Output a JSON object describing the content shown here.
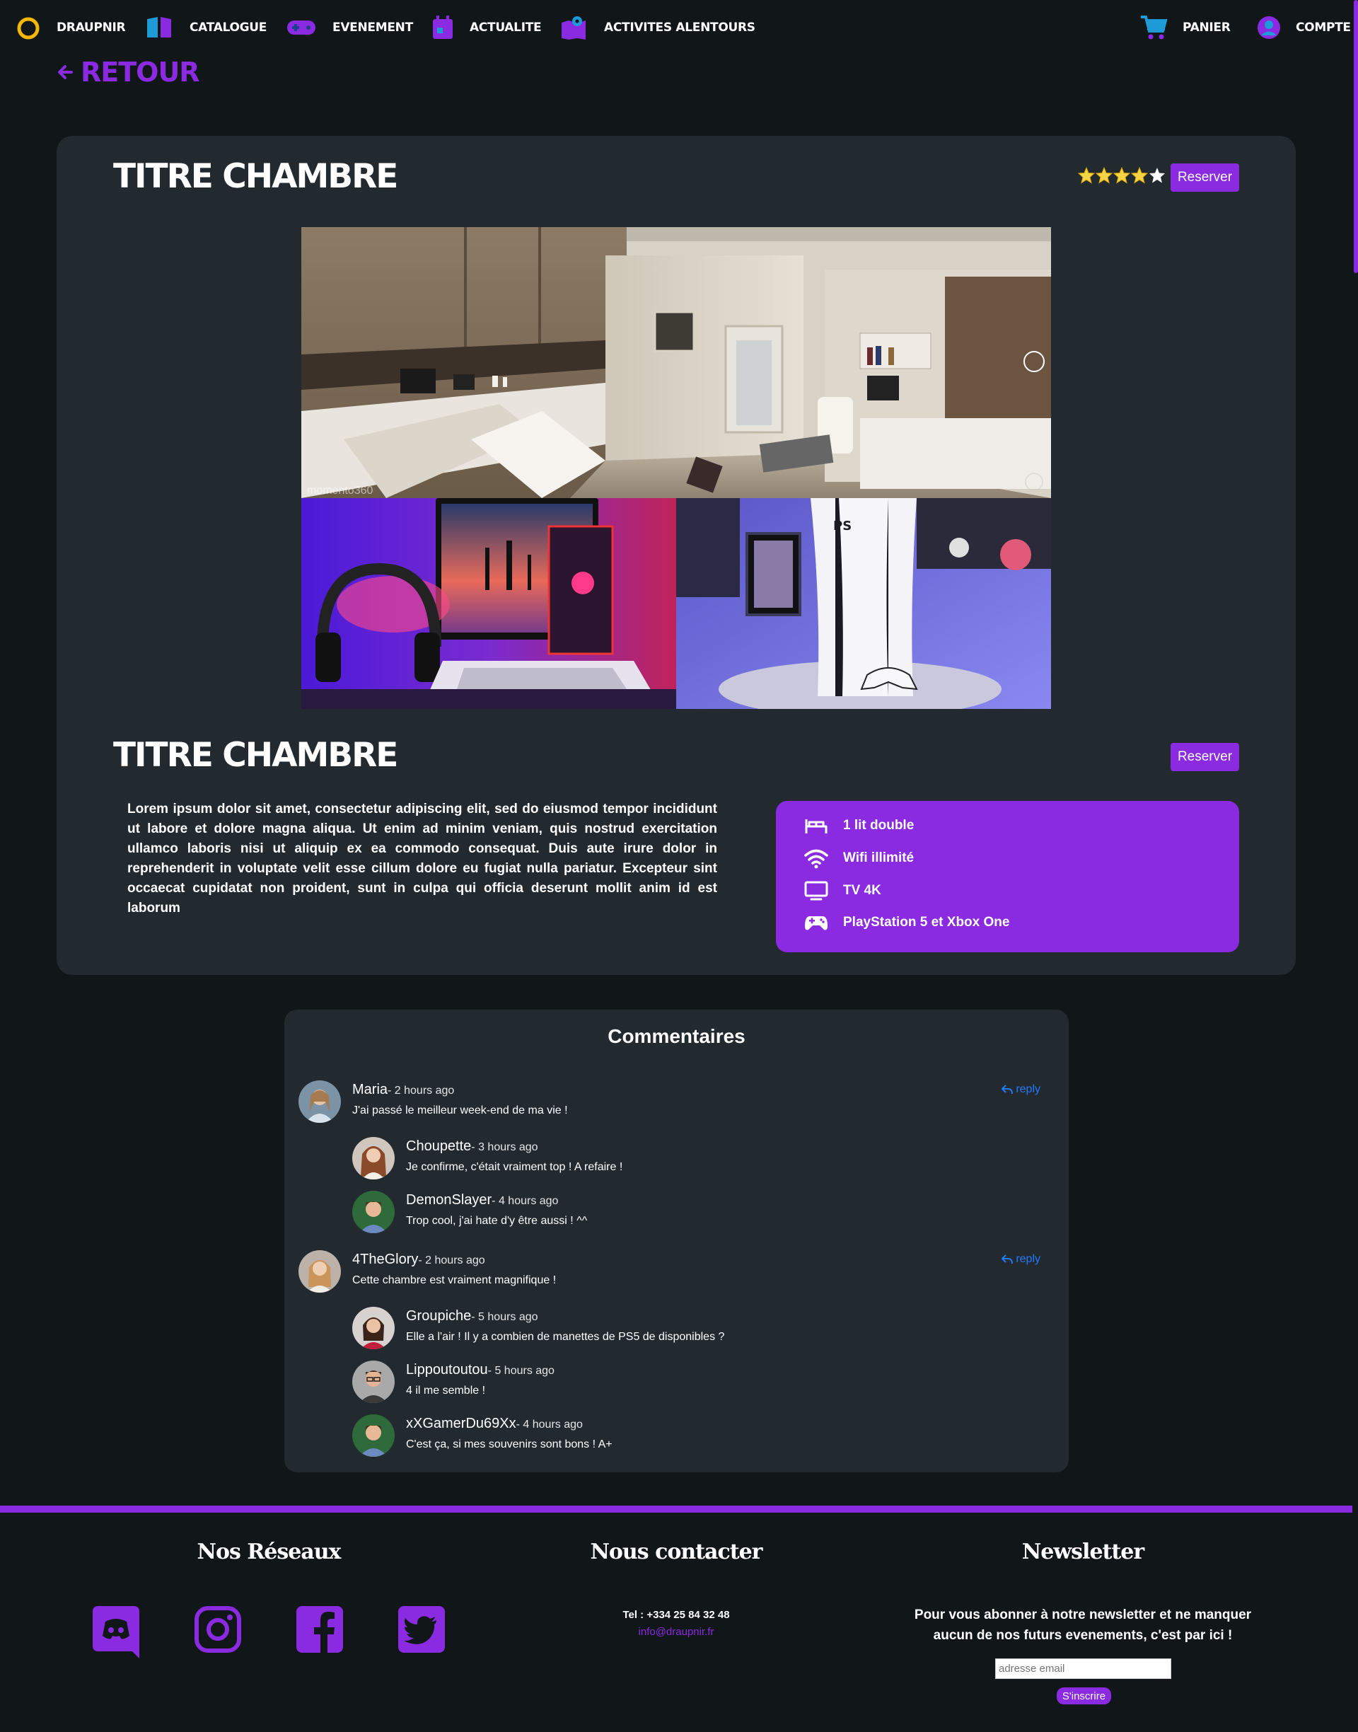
{
  "nav": {
    "brand": "DRAUPNIR",
    "items": [
      {
        "label": "CATALOGUE",
        "icon": "book-icon"
      },
      {
        "label": "EVENEMENT",
        "icon": "gamepad-icon"
      },
      {
        "label": "ACTUALITE",
        "icon": "calendar-icon"
      },
      {
        "label": "ACTIVITES ALENTOURS",
        "icon": "map-icon"
      }
    ],
    "cart": "PANIER",
    "account": "COMPTE"
  },
  "back_label": "RETOUR",
  "room": {
    "title": "TITRE CHAMBRE",
    "title_2": "TITRE CHAMBRE",
    "reserve_label": "Reserver",
    "rating": 4,
    "rating_max": 5,
    "photo_watermark": "momento360",
    "description": "Lorem ipsum dolor sit amet, consectetur adipiscing elit, sed do eiusmod tempor incididunt ut labore et dolore magna aliqua. Ut enim ad minim veniam, quis nostrud exercitation ullamco laboris nisi ut aliquip ex ea commodo consequat. Duis aute irure dolor in reprehenderit in voluptate velit esse cillum dolore eu fugiat nulla pariatur. Excepteur sint occaecat cupidatat non proident, sunt in culpa qui officia deserunt mollit anim id est laborum",
    "amenities": [
      {
        "label": "1 lit double",
        "icon": "bed-icon"
      },
      {
        "label": "Wifi illimité",
        "icon": "wifi-icon"
      },
      {
        "label": "TV 4K",
        "icon": "tv-icon"
      },
      {
        "label": "PlayStation 5 et Xbox One",
        "icon": "gamepad-icon"
      }
    ]
  },
  "comments": {
    "title": "Commentaires",
    "reply_label": "reply",
    "threads": [
      {
        "author": "Maria",
        "time": "- 2 hours ago",
        "text": "J'ai passé le meilleur week-end de ma vie !",
        "replies": [
          {
            "author": "Choupette",
            "time": "- 3 hours ago",
            "text": "Je confirme, c'était vraiment top ! A refaire !"
          },
          {
            "author": "DemonSlayer",
            "time": "- 4 hours ago",
            "text": "Trop cool, j'ai hate d'y être aussi ! ^^"
          }
        ]
      },
      {
        "author": "4TheGlory",
        "time": "- 2 hours ago",
        "text": "Cette chambre est vraiment magnifique !",
        "replies": [
          {
            "author": "Groupiche",
            "time": "- 5 hours ago",
            "text": "Elle a l'air ! Il y a combien de manettes de PS5 de disponibles ?"
          },
          {
            "author": "Lippoutoutou",
            "time": "- 5 hours ago",
            "text": "4 il me semble !"
          },
          {
            "author": "xXGamerDu69Xx",
            "time": "- 4 hours ago",
            "text": "C'est ça, si mes souvenirs sont bons ! A+"
          }
        ]
      }
    ]
  },
  "footer": {
    "social_title": "Nos Réseaux",
    "contact_title": "Nous contacter",
    "newsletter_title": "Newsletter",
    "phone": "Tel : +334 25 84 32 48",
    "email": "info@draupnir.fr",
    "newsletter_text": "Pour vous abonner à notre newsletter et ne manquer aucun de nos futurs evenements, c'est par ici !",
    "email_placeholder": "adresse email",
    "subscribe_label": "S'inscrire"
  },
  "colors": {
    "accent": "#8a2be2",
    "background": "#111618",
    "card": "#22292f",
    "star": "#f5d547",
    "link": "#1e7bff",
    "logo_ring": "#f5b800"
  }
}
